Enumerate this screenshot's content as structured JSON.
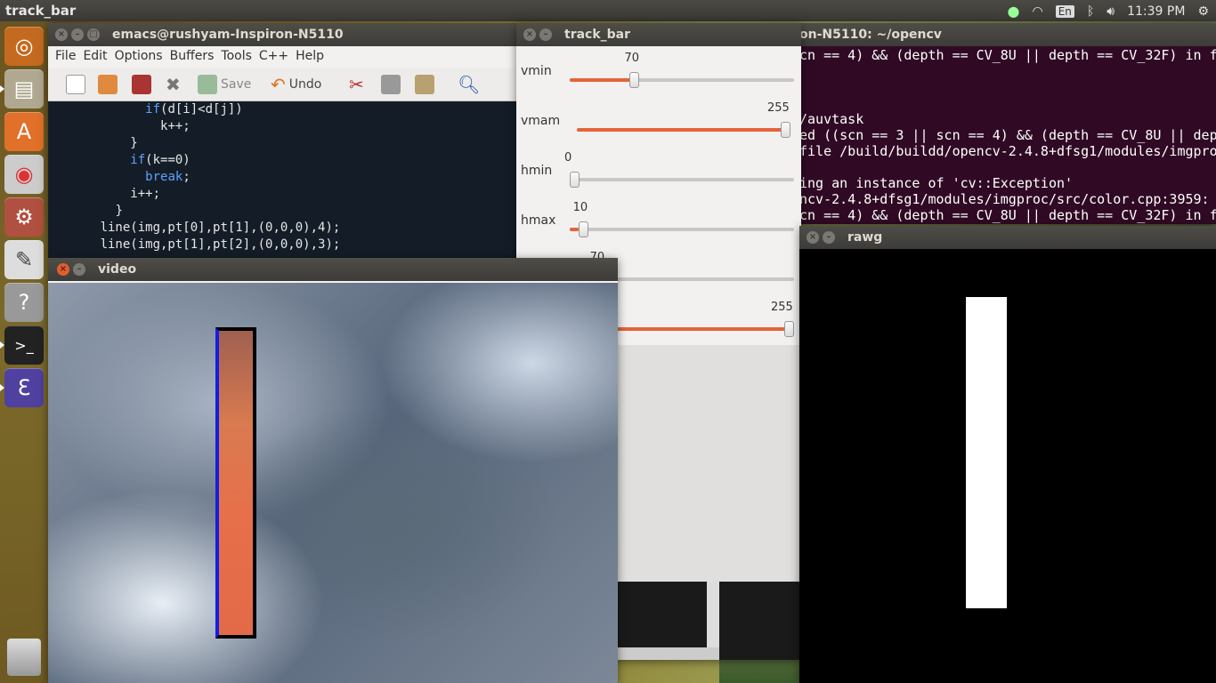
{
  "topbar": {
    "title": "track_bar",
    "lang": "En",
    "time": "11:39 PM"
  },
  "launcher": {
    "items": [
      "dash-icon",
      "files-icon",
      "software-center-icon",
      "chrome-icon",
      "settings-icon",
      "text-editor-icon",
      "help-icon",
      "terminal-icon",
      "emacs-icon",
      "trash-icon"
    ]
  },
  "terminal": {
    "title": "on-N5110: ~/opencv",
    "lines": [
      "cn == 4) && (depth == CV_8U || depth == CV_32F) in f",
      "",
      "",
      "",
      "/auvtask",
      "ed ((scn == 3 || scn == 4) && (depth == CV_8U || dep",
      "file /build/buildd/opencv-2.4.8+dfsg1/modules/imgpro",
      "",
      "ing an instance of 'cv::Exception'",
      "ncv-2.4.8+dfsg1/modules/imgproc/src/color.cpp:3959:",
      "cn == 4) && (depth == CV_8U || depth == CV_32F) in f"
    ]
  },
  "emacs": {
    "title": "emacs@rushyam-Inspiron-N5110",
    "menu": [
      "File",
      "Edit",
      "Options",
      "Buffers",
      "Tools",
      "C++",
      "Help"
    ],
    "toolbar": {
      "save": "Save",
      "undo": "Undo"
    },
    "code": [
      {
        "indent": "            ",
        "kw": "if",
        "rest": "(d[i]<d[j])"
      },
      {
        "indent": "              ",
        "kw": "",
        "rest": "k++;"
      },
      {
        "indent": "          ",
        "kw": "",
        "rest": "}"
      },
      {
        "indent": "          ",
        "kw": "if",
        "rest": "(k==0)"
      },
      {
        "indent": "            ",
        "kw": "break",
        "rest": ";"
      },
      {
        "indent": "          ",
        "kw": "",
        "rest": "i++;"
      },
      {
        "indent": "        ",
        "kw": "",
        "rest": "}"
      },
      {
        "indent": "      ",
        "kw": "",
        "rest": "line(img,pt[0],pt[1],(0,0,0),4);"
      },
      {
        "indent": "      ",
        "kw": "",
        "rest": "line(img,pt[1],pt[2],(0,0,0),3);"
      }
    ]
  },
  "trackbar": {
    "title": "track_bar",
    "sliders": [
      {
        "label": "vmin",
        "value": "70",
        "fraction": 0.28
      },
      {
        "label": "vmam",
        "value": "255",
        "fraction": 1.0
      },
      {
        "label": "hmin",
        "value": "0",
        "fraction": 0.0
      },
      {
        "label": "hmax",
        "value": "10",
        "fraction": 0.04
      },
      {
        "label": "",
        "value": "70",
        "fraction": 0.28
      },
      {
        "label": "",
        "value": "255",
        "fraction": 1.0
      }
    ]
  },
  "video": {
    "title": "video"
  },
  "rawg": {
    "title": "rawg"
  },
  "colors": {
    "accent": "#e5633a",
    "terminal_bg": "#300a24",
    "code_bg": "#141d27",
    "rect_blue": "#1020e0"
  }
}
